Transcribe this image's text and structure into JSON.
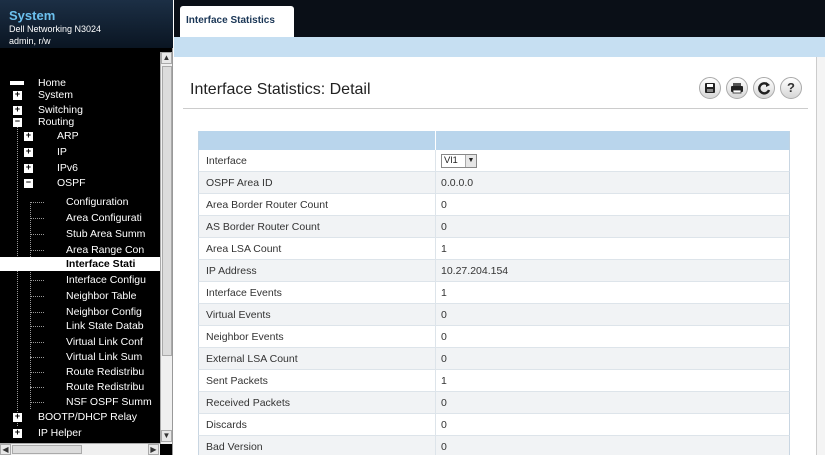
{
  "brand": {
    "title": "System",
    "device": "Dell Networking N3024",
    "user": "admin, r/w"
  },
  "nav": {
    "home": "Home",
    "system": "System",
    "switching": "Switching",
    "routing": "Routing",
    "arp": "ARP",
    "ip": "IP",
    "ipv6": "IPv6",
    "ospf": "OSPF",
    "ospf_items": [
      "Configuration",
      "Area Configurati",
      "Stub Area Summ",
      "Area Range Con",
      "Interface Stati",
      "Interface Configu",
      "Neighbor Table",
      "Neighbor Config",
      "Link State Datab",
      "Virtual Link Conf",
      "Virtual Link Sum",
      "Route Redistribu",
      "Route Redistribu",
      "NSF OSPF Summ"
    ],
    "bootp": "BOOTP/DHCP Relay",
    "iphelper": "IP Helper"
  },
  "tab": {
    "label": "Interface Statistics"
  },
  "page": {
    "title": "Interface Statistics: Detail"
  },
  "icons": [
    "save-icon",
    "print-icon",
    "refresh-icon",
    "help-icon"
  ],
  "table": {
    "interface_label": "Interface",
    "interface_value": "Vl1",
    "rows": [
      {
        "label": "OSPF Area ID",
        "value": "0.0.0.0"
      },
      {
        "label": "Area Border Router Count",
        "value": "0"
      },
      {
        "label": "AS Border Router Count",
        "value": "0"
      },
      {
        "label": "Area LSA Count",
        "value": "1"
      },
      {
        "label": "IP Address",
        "value": "10.27.204.154"
      },
      {
        "label": "Interface Events",
        "value": "1"
      },
      {
        "label": "Virtual Events",
        "value": "0"
      },
      {
        "label": "Neighbor Events",
        "value": "0"
      },
      {
        "label": "External LSA Count",
        "value": "0"
      },
      {
        "label": "Sent Packets",
        "value": "1"
      },
      {
        "label": "Received Packets",
        "value": "0"
      },
      {
        "label": "Discards",
        "value": "0"
      },
      {
        "label": "Bad Version",
        "value": "0"
      }
    ]
  }
}
